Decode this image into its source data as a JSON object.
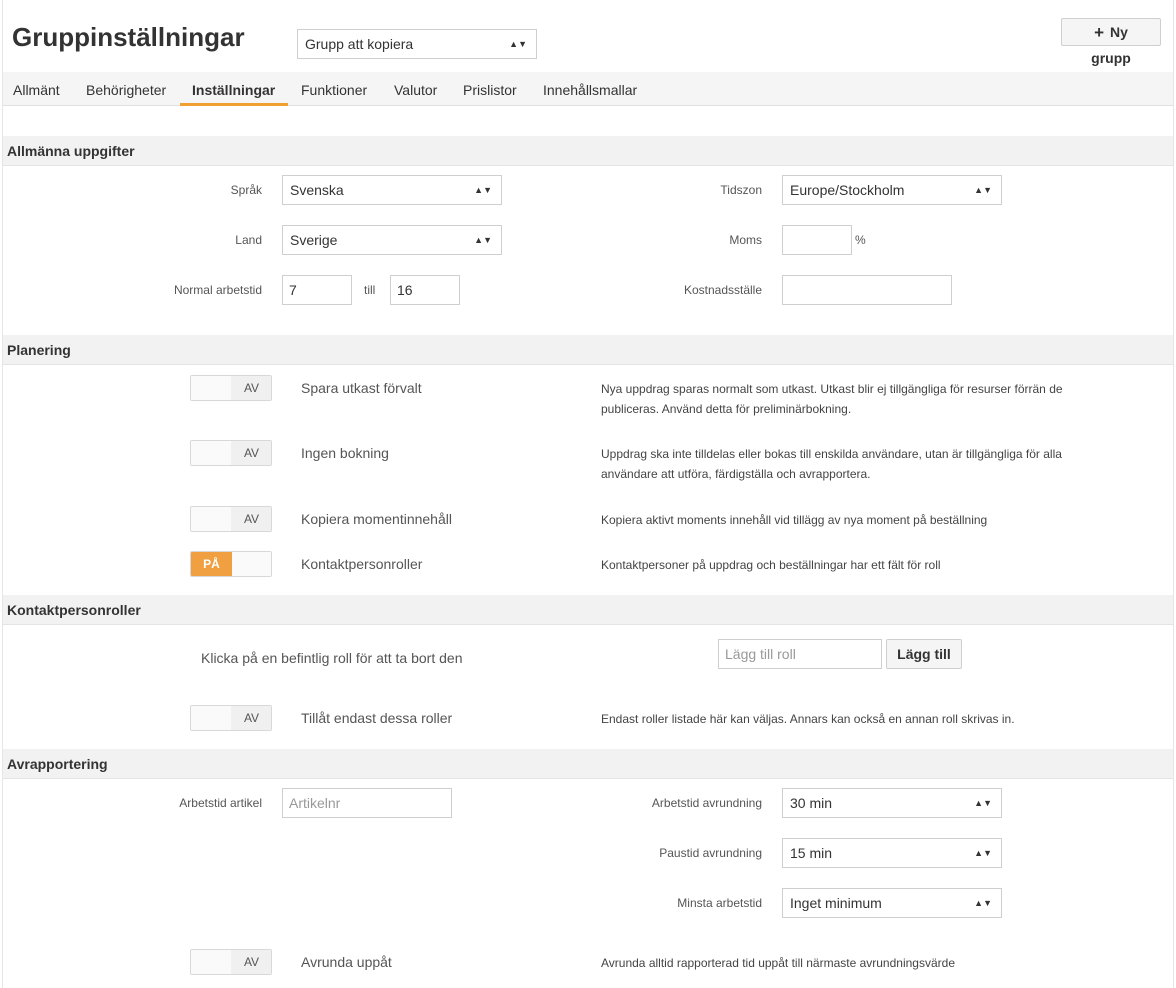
{
  "header": {
    "title": "Gruppinställningar",
    "copy_select": "Grupp att kopiera",
    "new_group_button": "Ny grupp"
  },
  "tabs": [
    {
      "label": "Allmänt",
      "active": false
    },
    {
      "label": "Behörigheter",
      "active": false
    },
    {
      "label": "Inställningar",
      "active": true
    },
    {
      "label": "Funktioner",
      "active": false
    },
    {
      "label": "Valutor",
      "active": false
    },
    {
      "label": "Prislistor",
      "active": false
    },
    {
      "label": "Innehållsmallar",
      "active": false
    }
  ],
  "general": {
    "heading": "Allmänna uppgifter",
    "language_label": "Språk",
    "language_value": "Svenska",
    "timezone_label": "Tidszon",
    "timezone_value": "Europe/Stockholm",
    "country_label": "Land",
    "country_value": "Sverige",
    "vat_label": "Moms",
    "vat_value": "",
    "vat_unit": "%",
    "worktime_label": "Normal arbetstid",
    "worktime_from": "7",
    "worktime_to_label": "till",
    "worktime_to": "16",
    "costcenter_label": "Kostnadsställe",
    "costcenter_value": ""
  },
  "planning": {
    "heading": "Planering",
    "items": [
      {
        "title": "Spara utkast förvalt",
        "state": "AV",
        "on": false,
        "desc": "Nya uppdrag sparas normalt som utkast. Utkast blir ej tillgängliga för resurser förrän de publiceras. Använd detta för preliminärbokning."
      },
      {
        "title": "Ingen bokning",
        "state": "AV",
        "on": false,
        "desc": "Uppdrag ska inte tilldelas eller bokas till enskilda användare, utan är tillgängliga för alla användare att utföra, färdigställa och avrapportera."
      },
      {
        "title": "Kopiera momentinnehåll",
        "state": "AV",
        "on": false,
        "desc": "Kopiera aktivt moments innehåll vid tillägg av nya moment på beställning"
      },
      {
        "title": "Kontaktpersonroller",
        "state": "PÅ",
        "on": true,
        "desc": "Kontaktpersoner på uppdrag och beställningar har ett fält för roll"
      }
    ]
  },
  "contact_roles": {
    "heading": "Kontaktpersonroller",
    "hint": "Klicka på en befintlig roll för att ta bort den",
    "add_placeholder": "Lägg till roll",
    "add_button": "Lägg till",
    "restrict_title": "Tillåt endast dessa roller",
    "restrict_state": "AV",
    "restrict_desc": "Endast roller listade här kan väljas. Annars kan också en annan roll skrivas in."
  },
  "reporting": {
    "heading": "Avrapportering",
    "article_label": "Arbetstid artikel",
    "article_placeholder": "Artikelnr",
    "work_rounding_label": "Arbetstid avrundning",
    "work_rounding_value": "30 min",
    "break_rounding_label": "Paustid avrundning",
    "break_rounding_value": "15 min",
    "min_worktime_label": "Minsta arbetstid",
    "min_worktime_value": "Inget minimum",
    "round_up_title": "Avrunda uppåt",
    "round_up_state": "AV",
    "round_up_desc": "Avrunda alltid rapporterad tid uppåt till närmaste avrundningsvärde"
  },
  "icons": {
    "select_arrow": "up-down-arrow-icon",
    "plus": "plus-icon"
  },
  "colors": {
    "accent": "#f0a030",
    "toggle_on": "#f0a040"
  }
}
